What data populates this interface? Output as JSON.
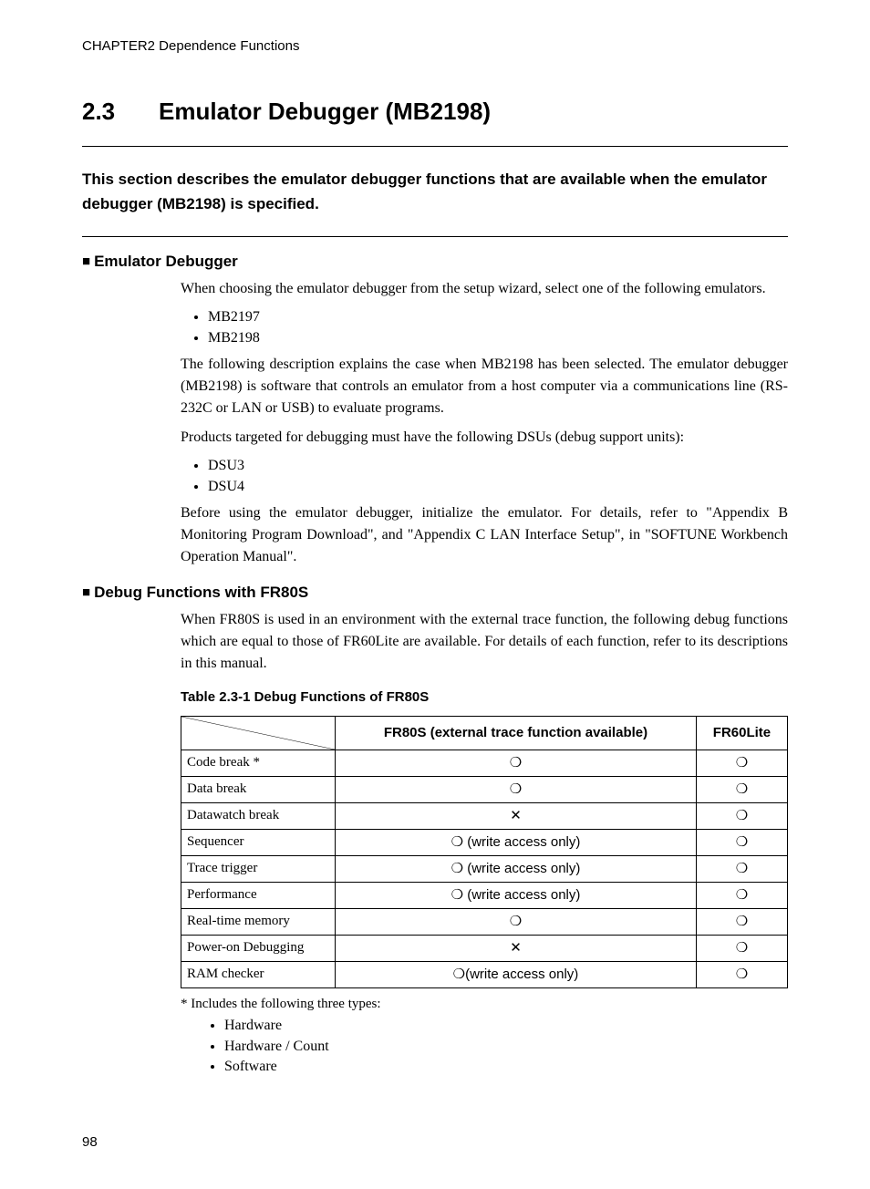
{
  "header": "CHAPTER2  Dependence Functions",
  "section_number": "2.3",
  "section_title": "Emulator Debugger (MB2198)",
  "summary": "This section describes the emulator debugger functions that are available when the emulator debugger (MB2198) is specified.",
  "sub1_title": "Emulator Debugger",
  "sub1_p1": "When choosing the emulator debugger from the setup wizard, select one of the following emulators.",
  "sub1_list1_a": "MB2197",
  "sub1_list1_b": "MB2198",
  "sub1_p2": "The following description explains the case when MB2198 has been selected. The emulator debugger (MB2198) is software that controls an emulator from a host computer via a communications line (RS-232C or LAN or USB) to evaluate programs.",
  "sub1_p3": "Products targeted for debugging must have the following DSUs (debug support units):",
  "sub1_list2_a": "DSU3",
  "sub1_list2_b": "DSU4",
  "sub1_p4": "Before using the emulator debugger, initialize the emulator.  For details, refer to \"Appendix B Monitoring Program Download\", and \"Appendix C LAN Interface Setup\", in \"SOFTUNE Workbench Operation Manual\".",
  "sub2_title": "Debug Functions with FR80S",
  "sub2_p1": "When FR80S is used in an environment with the external trace function, the following debug functions which are equal to those of FR60Lite are available. For details of each function, refer to its descriptions in this manual.",
  "table_caption": "Table 2.3-1  Debug Functions of FR80S",
  "table": {
    "col1": "FR80S (external trace function available)",
    "col2": "FR60Lite",
    "rows": [
      {
        "name": "Code break *",
        "c1": "❍",
        "c2": "❍"
      },
      {
        "name": "Data break",
        "c1": "❍",
        "c2": "❍"
      },
      {
        "name": "Datawatch break",
        "c1": "✕",
        "c2": "❍"
      },
      {
        "name": "Sequencer",
        "c1": "❍ (write access only)",
        "c2": "❍"
      },
      {
        "name": "Trace trigger",
        "c1": "❍ (write access only)",
        "c2": "❍"
      },
      {
        "name": "Performance",
        "c1": "❍ (write access only)",
        "c2": "❍"
      },
      {
        "name": "Real-time memory",
        "c1": "❍",
        "c2": "❍"
      },
      {
        "name": "Power-on Debugging",
        "c1": "✕",
        "c2": "❍"
      },
      {
        "name": "RAM checker",
        "c1": "❍(write access only)",
        "c2": "❍"
      }
    ]
  },
  "footnote_lead": "* Includes the following three types:",
  "footnote_list_a": "Hardware",
  "footnote_list_b": "Hardware / Count",
  "footnote_list_c": "Software",
  "page_number": "98"
}
